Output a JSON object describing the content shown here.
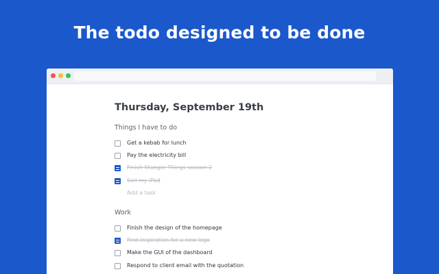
{
  "headline": "The todo designed to be done",
  "window": {
    "controls": [
      "close",
      "minimize",
      "maximize"
    ]
  },
  "date_title": "Thursday, September 19th",
  "sections": [
    {
      "title": "Things I have to do",
      "tasks": [
        {
          "label": "Get a kebab for lunch",
          "done": false
        },
        {
          "label": "Pay the electricity bill",
          "done": false
        },
        {
          "label": "Finish Stanger Things season 2",
          "done": true
        },
        {
          "label": "Sell my iPad",
          "done": true
        }
      ],
      "add_task": "Add a task"
    },
    {
      "title": "Work",
      "tasks": [
        {
          "label": "Finish the design of the homepage",
          "done": false
        },
        {
          "label": "Find inspiration for a new logo",
          "done": true
        },
        {
          "label": "Make the GUI of the dashboard",
          "done": false
        },
        {
          "label": "Respond to client email with the quotation",
          "done": false
        }
      ]
    }
  ],
  "colors": {
    "background": "#1b58cc",
    "checkbox_checked": "#1b58cc",
    "text": "#2f343b",
    "done_text": "#b5bac2"
  }
}
